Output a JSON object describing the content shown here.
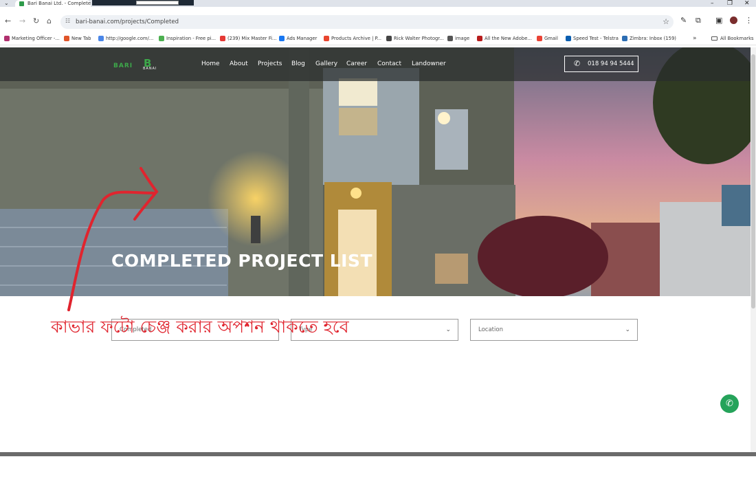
{
  "browser": {
    "tab_title": "Bari Banai Ltd. - Completed Pr",
    "url": "bari-banai.com/projects/Completed",
    "bookmarks": [
      {
        "label": "Marketing Officer -...",
        "icon_color": "#b0306e"
      },
      {
        "label": "New Tab",
        "icon_color": "#e0552a"
      },
      {
        "label": "http://google.com/...",
        "icon_color": "#4a86e8"
      },
      {
        "label": "Inspiration - Free pi...",
        "icon_color": "#4caf50"
      },
      {
        "label": "(239) Mix Master Fi...",
        "icon_color": "#e53935"
      },
      {
        "label": "Ads Manager",
        "icon_color": "#1877f2"
      },
      {
        "label": "Products Archive | P...",
        "icon_color": "#e8452f"
      },
      {
        "label": "Rick Walter Photogr...",
        "icon_color": "#444444"
      },
      {
        "label": "image",
        "icon_color": "#555555"
      },
      {
        "label": "All the New Adobe...",
        "icon_color": "#b71c1c"
      },
      {
        "label": "Gmail",
        "icon_color": "#ea4335"
      },
      {
        "label": "Speed Test - Telstra",
        "icon_color": "#0a5eb0"
      },
      {
        "label": "Zimbra: Inbox (159)",
        "icon_color": "#2c6db3"
      }
    ],
    "more_label": "»",
    "all_bookmarks_label": "All Bookmarks"
  },
  "site": {
    "logo_text_left": "BARI",
    "logo_text_mark": "B",
    "logo_text_sub": "BANAI",
    "nav": [
      "Home",
      "About",
      "Projects",
      "Blog",
      "Gallery",
      "Career",
      "Contact",
      "Landowner"
    ],
    "phone": "018 94 94 5444",
    "hero_title": "COMPLETED PROJECT LIST",
    "filters": [
      {
        "value": "Completed",
        "has_chevron": false
      },
      {
        "value": "Type",
        "has_chevron": true
      },
      {
        "value": "Location",
        "has_chevron": true
      }
    ]
  },
  "annotation": {
    "text": "কাভার ফটো চেঞ্জ করার অপশন থাকতে হবে",
    "color": "#e0242e"
  },
  "colors": {
    "brand_green": "#3da84a",
    "nav_bg": "#2c302f",
    "whatsapp": "#25a35a"
  }
}
